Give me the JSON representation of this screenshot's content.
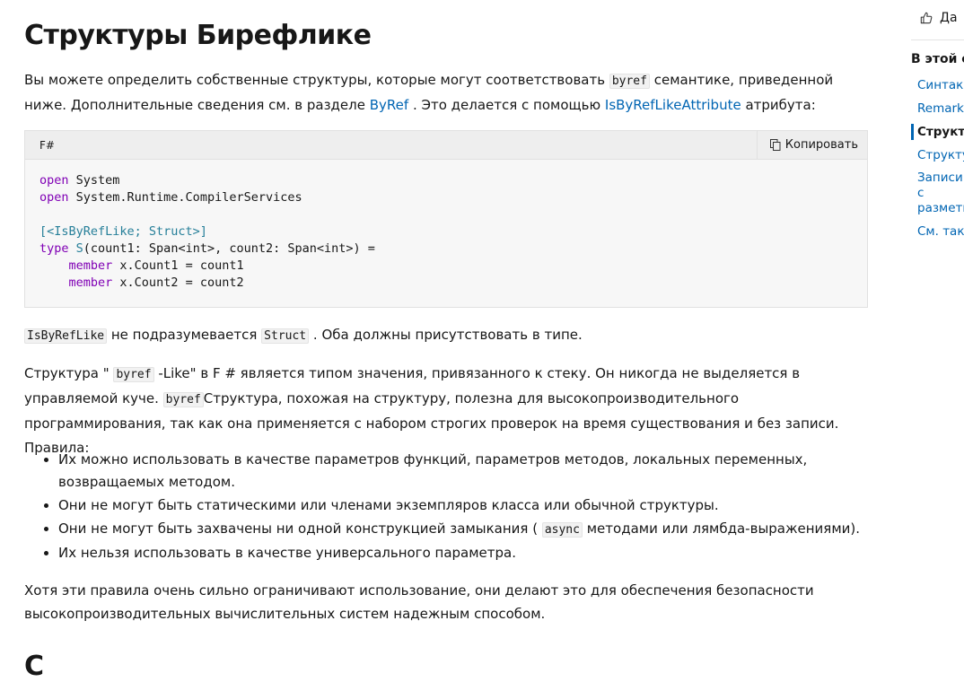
{
  "article": {
    "title": "Структуры Бирефлике",
    "p1": {
      "t1": "Вы можете определить собственные структуры, которые могут соответствовать ",
      "c1": "byref",
      "t2": " семантике, приведенной ниже. Дополнительные сведения см. в разделе ",
      "link1": "ByRef",
      "t3": " . Это делается с помощью ",
      "link2": "IsByRefLikeAttribute",
      "t4": " атрибута:"
    },
    "code_block": {
      "language": "F#",
      "copy_label": "Копировать",
      "lines": {
        "l1_kw": "open",
        "l1_rest": " System",
        "l2_kw": "open",
        "l2_rest": " System.Runtime.CompilerServices",
        "l4_attr": "[<IsByRefLike; Struct>]",
        "l5_kw": "type",
        "l5_name": " S",
        "l5_rest": "(count1: Span<int>, count2: Span<int>) =",
        "l6_indent": "    ",
        "l6_kw": "member",
        "l6_rest": " x.Count1 = count1",
        "l7_indent": "    ",
        "l7_kw": "member",
        "l7_rest": " x.Count2 = count2"
      }
    },
    "p2": {
      "c1": "IsByRefLike",
      "t1": " не подразумевается ",
      "c2": "Struct",
      "t2": " . Оба должны присутствовать в типе."
    },
    "p3": {
      "t1": "Структура \" ",
      "c1": "byref",
      "t2": " -Like\" в F # является типом значения, привязанного к стеку. Он никогда не выделяется в управляемой куче. ",
      "c2": "byref",
      "t3": "Структура, похожая на структуру, полезна для высокопроизводительного программирования, так как она применяется с набором строгих проверок на время существования и без записи. Правила:"
    },
    "rules": {
      "r1": "Их можно использовать в качестве параметров функций, параметров методов, локальных переменных, возвращаемых методом.",
      "r2": "Они не могут быть статическими или членами экземпляров класса или обычной структуры.",
      "r3_t1": "Они не могут быть захвачены ни одной конструкцией замыкания ( ",
      "r3_c1": "async",
      "r3_t2": " методами или лямбда-выражениями).",
      "r4": "Их нельзя использовать в качестве универсального параметра."
    },
    "p4": "Хотя эти правила очень сильно ограничивают использование, они делают это для обеспечения безопасности высокопроизводительных вычислительных систем надежным способом.",
    "next_heading": "С"
  },
  "rail": {
    "feedback_label": "Да",
    "toc_title": "В этой статье",
    "toc": [
      "Синтаксис",
      "Remarks",
      "Структуры Бирефлике",
      "Структуры",
      "Записи с разметкой",
      "См. также"
    ]
  }
}
